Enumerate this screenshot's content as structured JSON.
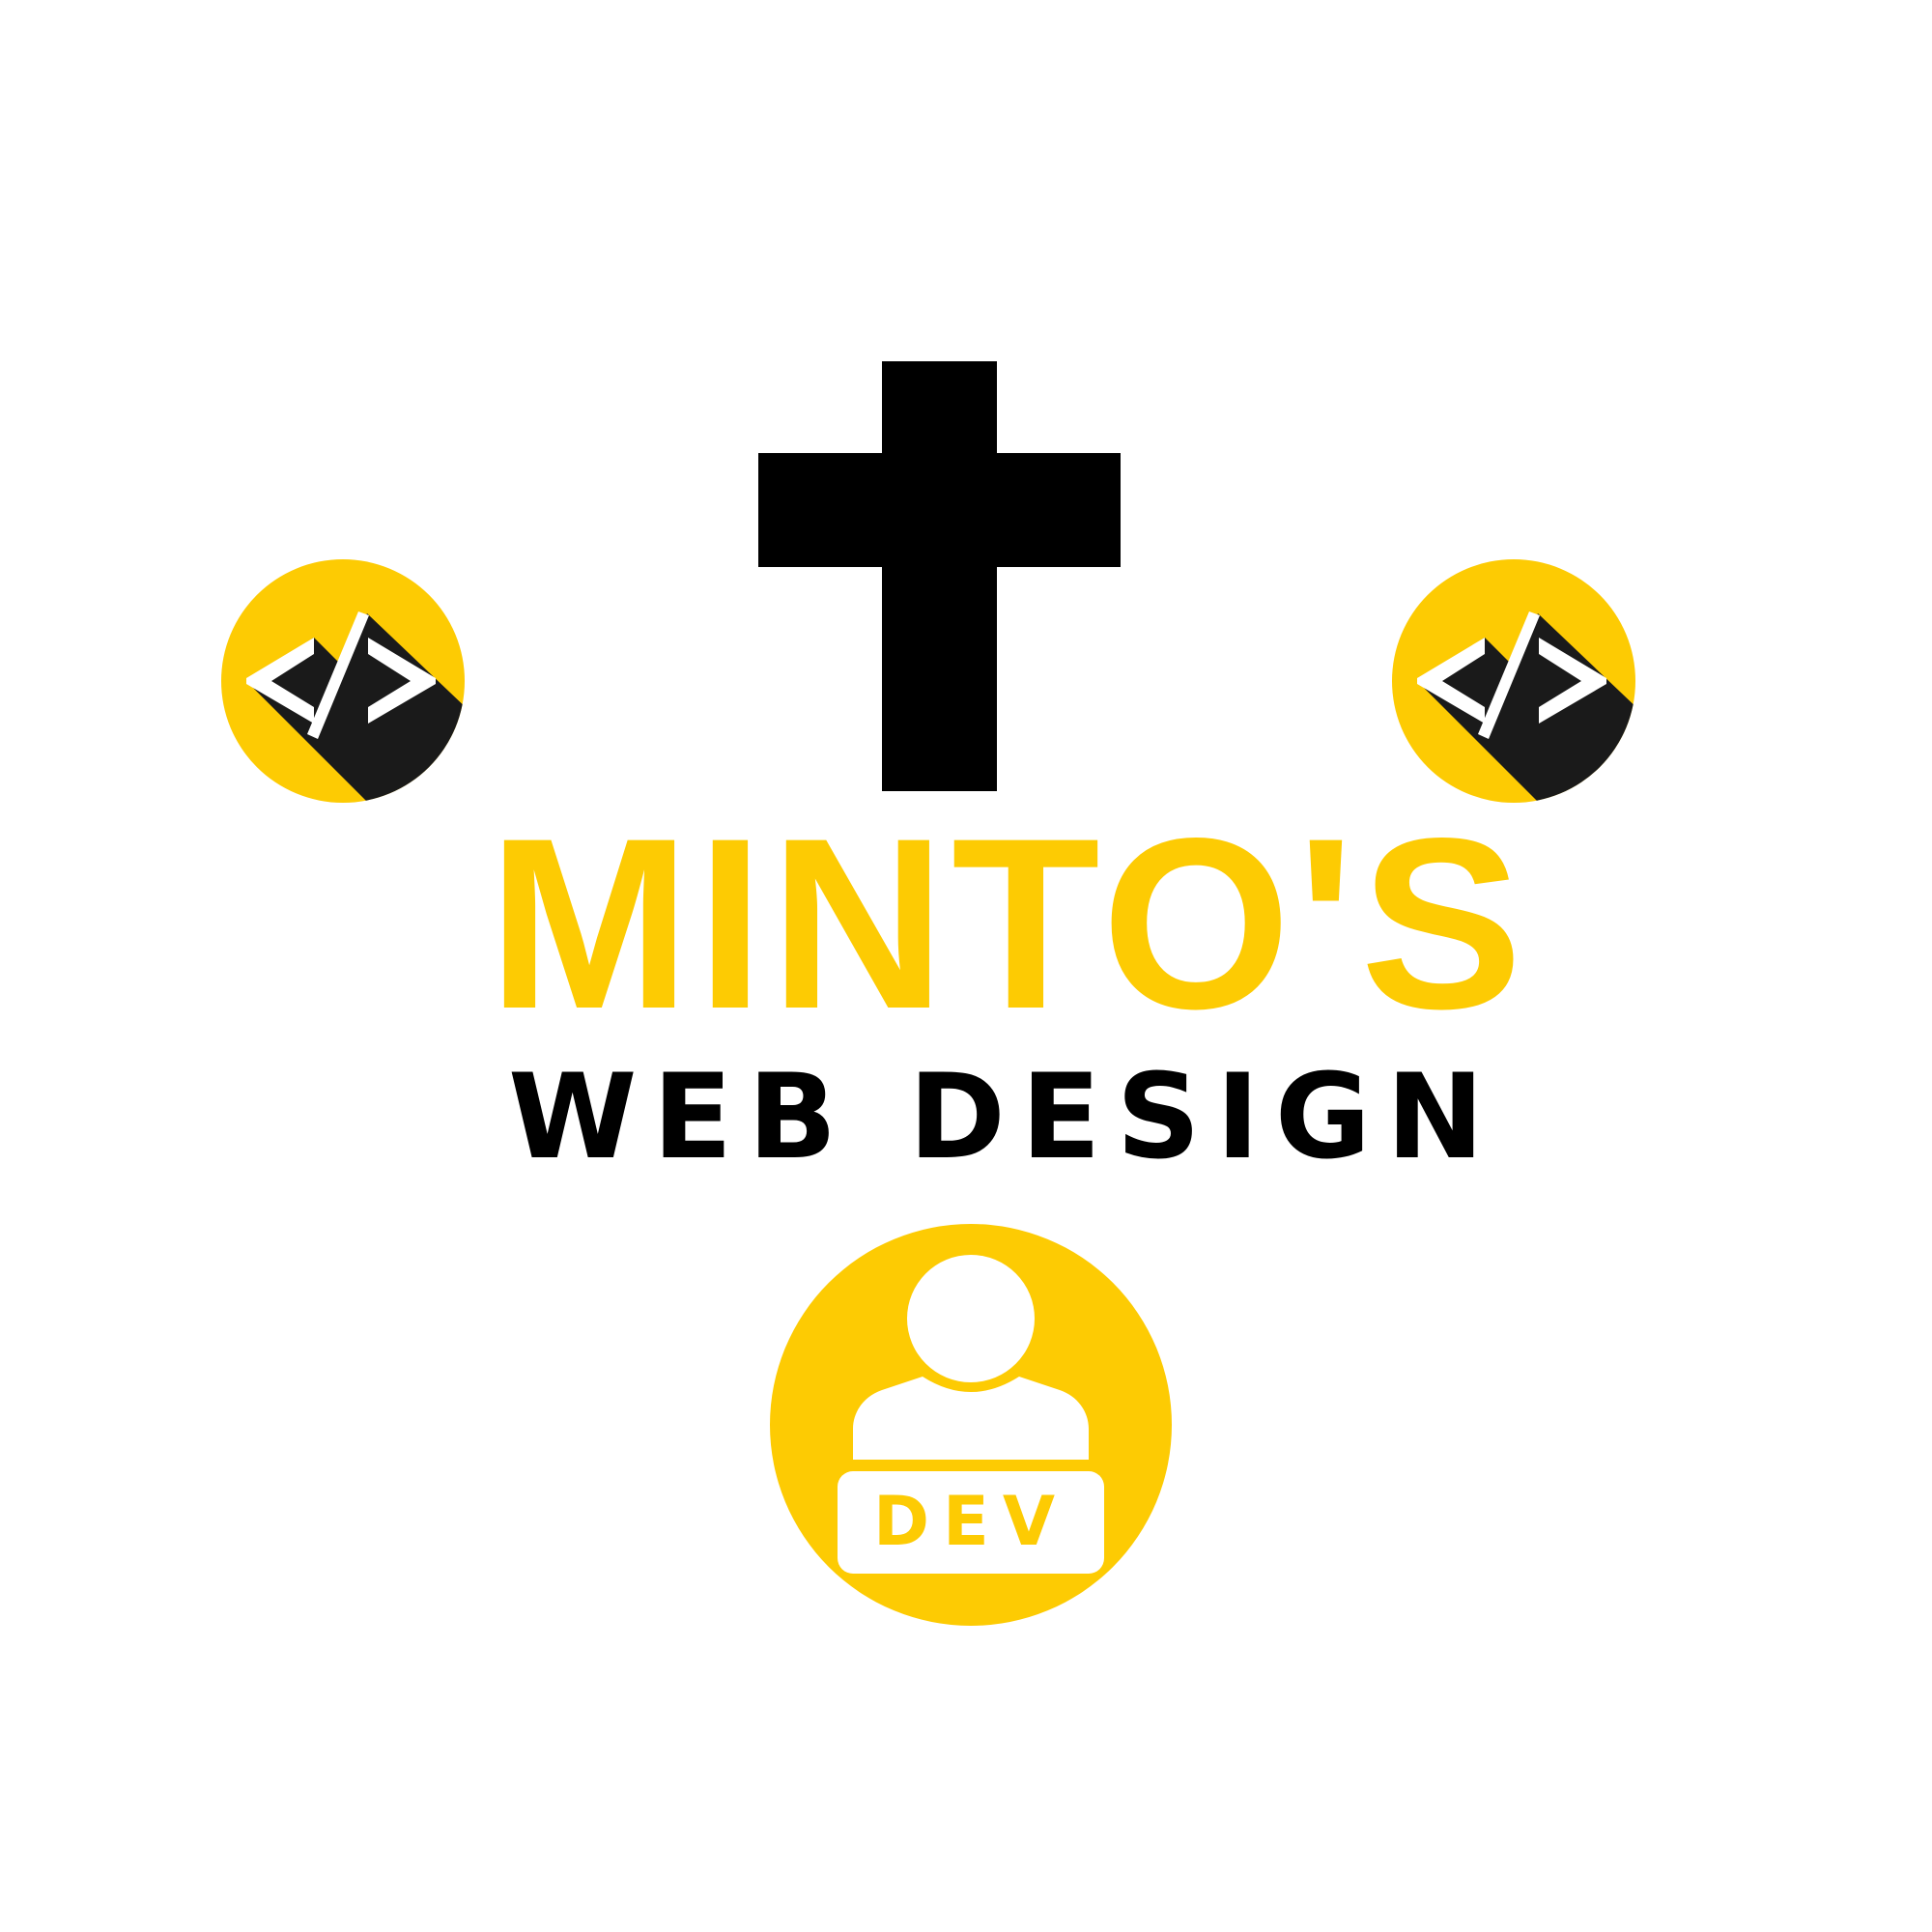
{
  "brand": {
    "name": "MINTO'S",
    "tagline": "WEB DESIGN",
    "badge_label": "DEV"
  },
  "colors": {
    "accent": "#FDCB03",
    "dark": "#1A1A1A",
    "black": "#000000",
    "white": "#FFFFFF"
  },
  "icons": {
    "top": "cross-icon",
    "left": "code-icon",
    "right": "code-icon",
    "bottom": "developer-person-icon"
  }
}
